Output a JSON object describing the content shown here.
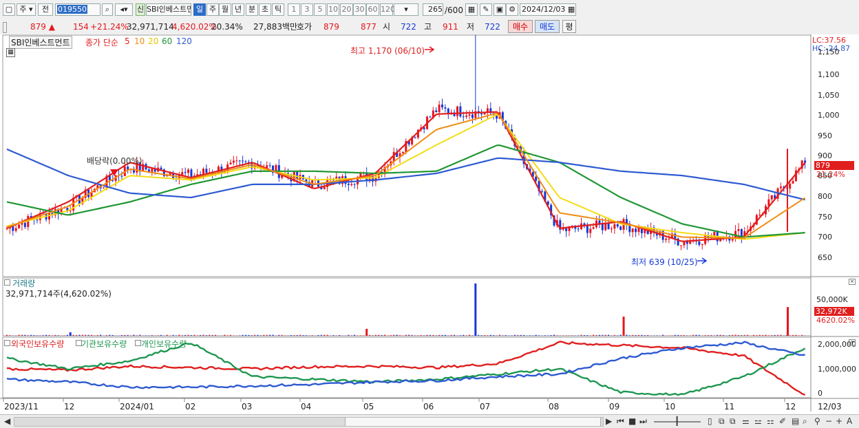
{
  "toolbar": {
    "period_select": "주",
    "prev_label": "전",
    "code_value": "019550",
    "stock_name_badge": "신",
    "stock_name": "SBI인베스트먼트",
    "period_buttons": [
      "일",
      "주",
      "월",
      "년",
      "분",
      "초",
      "틱"
    ],
    "interval_buttons": [
      "1",
      "3",
      "5",
      "10",
      "20",
      "30",
      "60",
      "120"
    ],
    "count_value": "265",
    "count_total": "/600",
    "date_value": "2024/12/03"
  },
  "quote": {
    "price": "879 ▲",
    "change": "154",
    "change_pct": "+21.24%",
    "volume": "32,971,714",
    "volume_pct": "4,620.02%",
    "turnover": "20.34%",
    "amount": "27,883백만",
    "bid_label": "호가",
    "ask_price": "879",
    "bid_price": "877",
    "open_label": "시",
    "open_value": "722",
    "high_label": "고",
    "high_value": "911",
    "low_label": "저",
    "low_value": "722",
    "buy_label": "매수",
    "sell_label": "매도",
    "eval_label": "평"
  },
  "main_pane": {
    "name": "SBI인베스트먼트",
    "price_legend": "종가 단순",
    "ma_periods": [
      "5",
      "10",
      "20",
      "60",
      "120"
    ],
    "lc": "LC:37.56",
    "hc": "HC:-24.87",
    "high_annot": "최고 1,170 (06/10)",
    "low_annot": "최저 639 (10/25)",
    "dividend_annot": "배당락(0.00%)",
    "price_ticks": [
      "1,150",
      "1,100",
      "1,050",
      "1,000",
      "950",
      "900",
      "850",
      "800",
      "750",
      "700",
      "650"
    ],
    "last_price_tag": "879",
    "last_pct_tag": "21.24%"
  },
  "volume_pane": {
    "title": "거래량",
    "value": "32,971,714주(4,620.02%)",
    "tick": "50,000K",
    "last_tag": "32,972K",
    "last_pct": "4620.02%"
  },
  "holding_pane": {
    "legend": [
      "외국인보유수량",
      "기관보유수량",
      "개인보유수량"
    ],
    "ticks": [
      "2,000,000",
      "1,000,000",
      "0"
    ]
  },
  "x_axis": {
    "labels": [
      "2023/11",
      "12",
      "2024/01",
      "02",
      "03",
      "04",
      "05",
      "06",
      "07",
      "08",
      "09",
      "10",
      "11",
      "12"
    ],
    "end_label": "12/03"
  },
  "colors": {
    "up": "#e8141b",
    "down": "#1637d6",
    "ma5": "#e01e1e",
    "ma10": "#f08c14",
    "ma20": "#f5dc14",
    "ma60": "#1e9632",
    "ma120": "#2d5ad2",
    "foreign": "#e01e1e",
    "institution": "#1e9650",
    "individual": "#2d5ad2"
  },
  "chart_data": {
    "type": "line",
    "title": "SBI인베스트먼트 주봉",
    "x_start": "2023/11",
    "x_end": "12/03",
    "ylim": [
      620,
      1165
    ],
    "key_points": [
      {
        "x": "2023/11",
        "close": 730
      },
      {
        "x": "12",
        "close": 780
      },
      {
        "x": "2024/01",
        "close": 870
      },
      {
        "x": "02",
        "close": 850
      },
      {
        "x": "03",
        "close": 880
      },
      {
        "x": "04",
        "close": 830
      },
      {
        "x": "05",
        "close": 850
      },
      {
        "x": "06",
        "close": 1000,
        "high": 1170
      },
      {
        "x": "07",
        "close": 990
      },
      {
        "x": "08",
        "close": 725
      },
      {
        "x": "09",
        "close": 740
      },
      {
        "x": "10",
        "close": 700,
        "low": 639
      },
      {
        "x": "11",
        "close": 720
      },
      {
        "x": "12/03",
        "close": 879,
        "high": 911
      }
    ],
    "series": [
      {
        "name": "5",
        "values": [
          730,
          790,
          880,
          845,
          880,
          820,
          855,
          990,
          995,
          730,
          745,
          700,
          710,
          879
        ]
      },
      {
        "name": "20",
        "values": [
          735,
          770,
          850,
          840,
          870,
          840,
          845,
          920,
          990,
          800,
          740,
          720,
          705,
          720
        ]
      },
      {
        "name": "60",
        "values": [
          790,
          760,
          790,
          830,
          860,
          860,
          855,
          860,
          920,
          880,
          800,
          740,
          710,
          720
        ]
      },
      {
        "name": "120",
        "values": [
          910,
          850,
          810,
          800,
          830,
          830,
          840,
          855,
          890,
          880,
          860,
          850,
          830,
          795
        ]
      }
    ],
    "volume_max_k": 60000,
    "volume_last_k": 32972
  }
}
